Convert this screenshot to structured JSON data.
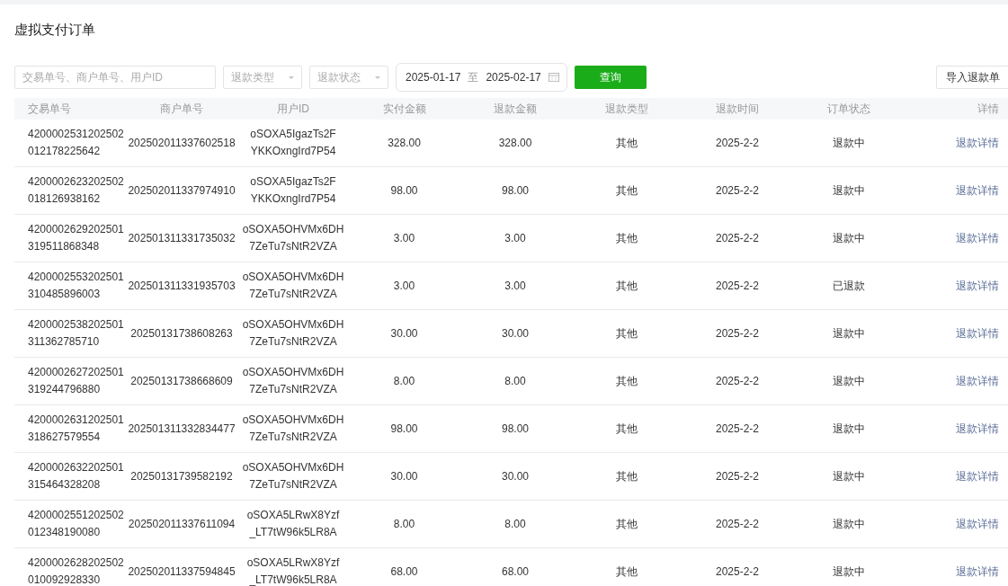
{
  "title": "虚拟支付订单",
  "filters": {
    "search": {
      "placeholder": "交易单号、商户单号、用户ID"
    },
    "selects": [
      {
        "placeholder": "退款类型"
      },
      {
        "placeholder": "退款状态"
      }
    ],
    "date_range": {
      "start": "2025-01-17",
      "separator": "至",
      "end": "2025-02-17"
    },
    "query_button": "查询",
    "import_button": "导入退款单"
  },
  "table": {
    "columns": [
      "交易单号",
      "商户单号",
      "用户ID",
      "实付金额",
      "退款金额",
      "退款类型",
      "退款时间",
      "订单状态",
      "详情"
    ],
    "rows": [
      {
        "transaction_no": "4200002531202502012178225642",
        "merchant_no": "202502011337602518",
        "user_id": "oSOXA5IgazTs2FYKKOxngIrd7P54",
        "paid": "328.00",
        "refund": "328.00",
        "refund_type": "其他",
        "refund_time": "2025-2-2",
        "status": "退款中",
        "detail": "退款详情"
      },
      {
        "transaction_no": "4200002623202502018126938162",
        "merchant_no": "202502011337974910",
        "user_id": "oSOXA5IgazTs2FYKKOxngIrd7P54",
        "paid": "98.00",
        "refund": "98.00",
        "refund_type": "其他",
        "refund_time": "2025-2-2",
        "status": "退款中",
        "detail": "退款详情"
      },
      {
        "transaction_no": "4200002629202501319511868348",
        "merchant_no": "202501311331735032",
        "user_id": "oSOXA5OHVMx6DH7ZeTu7sNtR2VZA",
        "paid": "3.00",
        "refund": "3.00",
        "refund_type": "其他",
        "refund_time": "2025-2-2",
        "status": "退款中",
        "detail": "退款详情"
      },
      {
        "transaction_no": "4200002553202501310485896003",
        "merchant_no": "202501311331935703",
        "user_id": "oSOXA5OHVMx6DH7ZeTu7sNtR2VZA",
        "paid": "3.00",
        "refund": "3.00",
        "refund_type": "其他",
        "refund_time": "2025-2-2",
        "status": "已退款",
        "detail": "退款详情"
      },
      {
        "transaction_no": "4200002538202501311362785710",
        "merchant_no": "20250131738608263",
        "user_id": "oSOXA5OHVMx6DH7ZeTu7sNtR2VZA",
        "paid": "30.00",
        "refund": "30.00",
        "refund_type": "其他",
        "refund_time": "2025-2-2",
        "status": "退款中",
        "detail": "退款详情"
      },
      {
        "transaction_no": "4200002627202501319244796880",
        "merchant_no": "20250131738668609",
        "user_id": "oSOXA5OHVMx6DH7ZeTu7sNtR2VZA",
        "paid": "8.00",
        "refund": "8.00",
        "refund_type": "其他",
        "refund_time": "2025-2-2",
        "status": "退款中",
        "detail": "退款详情"
      },
      {
        "transaction_no": "4200002631202501318627579554",
        "merchant_no": "202501311332834477",
        "user_id": "oSOXA5OHVMx6DH7ZeTu7sNtR2VZA",
        "paid": "98.00",
        "refund": "98.00",
        "refund_type": "其他",
        "refund_time": "2025-2-2",
        "status": "退款中",
        "detail": "退款详情"
      },
      {
        "transaction_no": "4200002632202501315464328208",
        "merchant_no": "20250131739582192",
        "user_id": "oSOXA5OHVMx6DH7ZeTu7sNtR2VZA",
        "paid": "30.00",
        "refund": "30.00",
        "refund_type": "其他",
        "refund_time": "2025-2-2",
        "status": "退款中",
        "detail": "退款详情"
      },
      {
        "transaction_no": "4200002551202502012348190080",
        "merchant_no": "202502011337611094",
        "user_id": "oSOXA5LRwX8Yzf_LT7tW96k5LR8A",
        "paid": "8.00",
        "refund": "8.00",
        "refund_type": "其他",
        "refund_time": "2025-2-2",
        "status": "退款中",
        "detail": "退款详情"
      },
      {
        "transaction_no": "4200002628202502010092928330",
        "merchant_no": "202502011337594845",
        "user_id": "oSOXA5LRwX8Yzf_LT7tW96k5LR8A",
        "paid": "68.00",
        "refund": "68.00",
        "refund_type": "其他",
        "refund_time": "2025-2-2",
        "status": "退款中",
        "detail": "退款详情"
      }
    ]
  }
}
